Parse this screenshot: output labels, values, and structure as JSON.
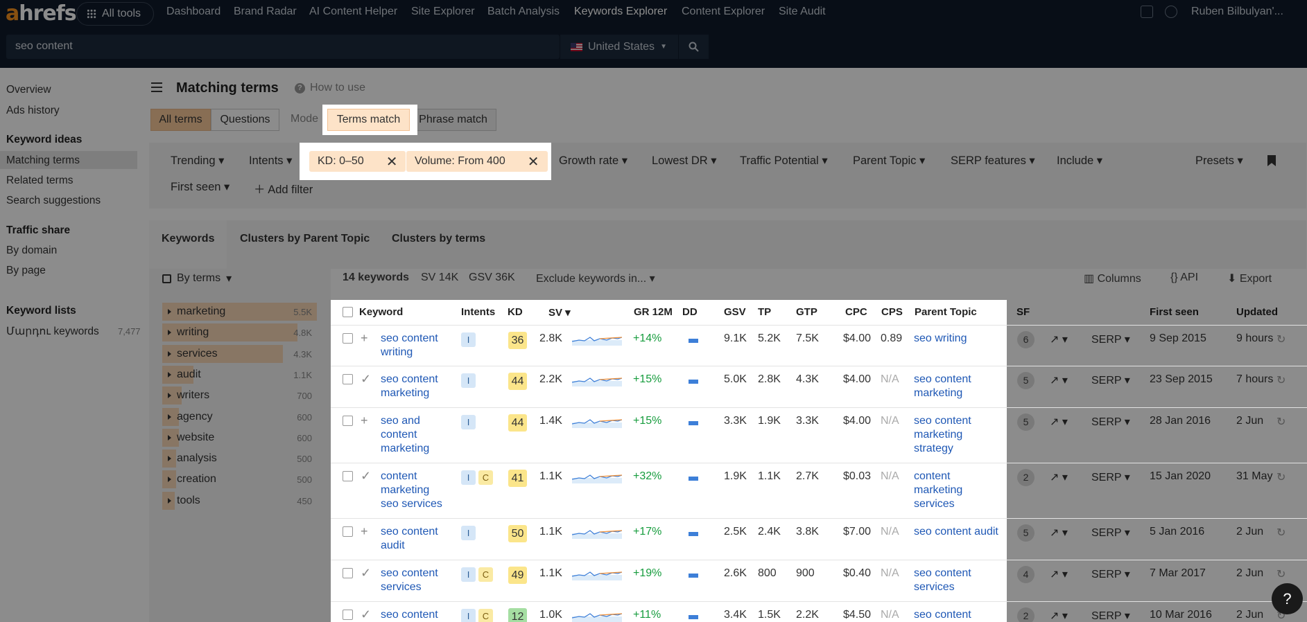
{
  "header": {
    "logo_a": "a",
    "logo_rest": "hrefs",
    "all_tools": "All tools",
    "nav": [
      "Dashboard",
      "Brand Radar",
      "AI Content Helper",
      "Site Explorer",
      "Batch Analysis",
      "Keywords Explorer",
      "Content Explorer",
      "Site Audit"
    ],
    "user": "Ruben Bilbulyan'..."
  },
  "search": {
    "value": "seo content",
    "country": "United States"
  },
  "sidebar": {
    "top": [
      "Overview",
      "Ads history"
    ],
    "keyword_ideas": "Keyword ideas",
    "ideas": [
      "Matching terms",
      "Related terms",
      "Search suggestions"
    ],
    "traffic_share": "Traffic share",
    "traffic": [
      "By domain",
      "By page"
    ],
    "keyword_lists": "Keyword lists",
    "list_name": "Մարդու keywords",
    "list_count": "7,477"
  },
  "page": {
    "title": "Matching terms",
    "how_to": "How to use",
    "all_terms": "All terms",
    "questions": "Questions",
    "mode": "Mode",
    "terms_match": "Terms match",
    "phrase_match": "Phrase match"
  },
  "filters": {
    "trending": "Trending",
    "intents": "Intents",
    "kd_chip": "KD: 0–50",
    "volume_chip": "Volume: From 400",
    "growth": "Growth rate",
    "lowest_dr": "Lowest DR",
    "traffic_potential": "Traffic Potential",
    "parent_topic": "Parent Topic",
    "serp_features": "SERP features",
    "include": "Include",
    "presets": "Presets",
    "first_seen": "First seen",
    "add_filter": "Add filter"
  },
  "tabs": {
    "keywords": "Keywords",
    "clusters_parent": "Clusters by Parent Topic",
    "clusters_terms": "Clusters by terms"
  },
  "terms": {
    "by_terms": "By terms",
    "items": [
      {
        "t": "marketing",
        "c": "5.5K",
        "w": 1.0
      },
      {
        "t": "writing",
        "c": "4.8K",
        "w": 0.873
      },
      {
        "t": "services",
        "c": "4.3K",
        "w": 0.782
      },
      {
        "t": "audit",
        "c": "1.1K",
        "w": 0.2
      },
      {
        "t": "writers",
        "c": "700",
        "w": 0.127
      },
      {
        "t": "agency",
        "c": "600",
        "w": 0.109
      },
      {
        "t": "website",
        "c": "600",
        "w": 0.109
      },
      {
        "t": "analysis",
        "c": "500",
        "w": 0.091
      },
      {
        "t": "creation",
        "c": "500",
        "w": 0.091
      },
      {
        "t": "tools",
        "c": "450",
        "w": 0.082
      }
    ]
  },
  "summary": {
    "count": "14 keywords",
    "sv": "SV 14K",
    "gsv": "GSV 36K",
    "exclude": "Exclude keywords in...",
    "columns": "Columns",
    "api": "API",
    "export": "Export"
  },
  "columns": [
    "Keyword",
    "Intents",
    "KD",
    "SV",
    "GR 12M",
    "DD",
    "GSV",
    "TP",
    "GTP",
    "CPC",
    "CPS",
    "Parent Topic",
    "SF",
    "First seen",
    "Updated"
  ],
  "rows": [
    {
      "kw": [
        "seo content",
        "writing"
      ],
      "mark": "+",
      "intents": [
        "I"
      ],
      "kd": "36",
      "kdColor": "#fbe58a",
      "sv": "2.8K",
      "gr": "+14%",
      "gsv": "9.1K",
      "tp": "5.2K",
      "gtp": "7.5K",
      "cpc": "$4.00",
      "cps": "0.89",
      "pt": [
        "seo writing"
      ],
      "sf": "6",
      "serp": "SERP",
      "first": "9 Sep 2015",
      "upd": "9 hours"
    },
    {
      "kw": [
        "seo content",
        "marketing"
      ],
      "mark": "✓",
      "intents": [
        "I"
      ],
      "kd": "44",
      "kdColor": "#fbe58a",
      "sv": "2.2K",
      "gr": "+15%",
      "gsv": "5.0K",
      "tp": "2.8K",
      "gtp": "4.3K",
      "cpc": "$4.00",
      "cps": "N/A",
      "pt": [
        "seo content",
        "marketing"
      ],
      "sf": "5",
      "serp": "SERP",
      "first": "23 Sep 2015",
      "upd": "7 hours"
    },
    {
      "kw": [
        "seo and",
        "content",
        "marketing"
      ],
      "mark": "+",
      "intents": [
        "I"
      ],
      "kd": "44",
      "kdColor": "#fbe58a",
      "sv": "1.4K",
      "gr": "+15%",
      "gsv": "3.3K",
      "tp": "1.9K",
      "gtp": "3.3K",
      "cpc": "$4.00",
      "cps": "N/A",
      "pt": [
        "seo content",
        "marketing",
        "strategy"
      ],
      "sf": "5",
      "serp": "SERP",
      "first": "28 Jan 2016",
      "upd": "2 Jun"
    },
    {
      "kw": [
        "content",
        "marketing",
        "seo services"
      ],
      "mark": "✓",
      "intents": [
        "I",
        "C"
      ],
      "kd": "41",
      "kdColor": "#fbe58a",
      "sv": "1.1K",
      "gr": "+32%",
      "gsv": "1.9K",
      "tp": "1.1K",
      "gtp": "2.7K",
      "cpc": "$0.03",
      "cps": "N/A",
      "pt": [
        "content",
        "marketing",
        "services"
      ],
      "sf": "2",
      "serp": "SERP",
      "first": "15 Jan 2020",
      "upd": "31 May"
    },
    {
      "kw": [
        "seo content",
        "audit"
      ],
      "mark": "+",
      "intents": [
        "I"
      ],
      "kd": "50",
      "kdColor": "#fbe58a",
      "sv": "1.1K",
      "gr": "+17%",
      "gsv": "2.5K",
      "tp": "2.4K",
      "gtp": "3.8K",
      "cpc": "$7.00",
      "cps": "N/A",
      "pt": [
        "seo content audit"
      ],
      "sf": "5",
      "serp": "SERP",
      "first": "5 Jan 2016",
      "upd": "2 Jun"
    },
    {
      "kw": [
        "seo content",
        "services"
      ],
      "mark": "✓",
      "intents": [
        "I",
        "C"
      ],
      "kd": "49",
      "kdColor": "#fbe58a",
      "sv": "1.1K",
      "gr": "+19%",
      "gsv": "2.6K",
      "tp": "800",
      "gtp": "900",
      "cpc": "$0.40",
      "cps": "N/A",
      "pt": [
        "seo content",
        "services"
      ],
      "sf": "4",
      "serp": "SERP",
      "first": "7 Mar 2017",
      "upd": "2 Jun"
    },
    {
      "kw": [
        "seo content"
      ],
      "mark": "✓",
      "intents": [
        "I",
        "C"
      ],
      "kd": "12",
      "kdColor": "#a5dea2",
      "sv": "1.0K",
      "gr": "+11%",
      "gsv": "3.4K",
      "tp": "1.5K",
      "gtp": "2.2K",
      "cpc": "$4.50",
      "cps": "N/A",
      "pt": [
        "seo content"
      ],
      "sf": "2",
      "serp": "SERP",
      "first": "10 Mar 2016",
      "upd": "2 Jun"
    }
  ],
  "help": "?"
}
